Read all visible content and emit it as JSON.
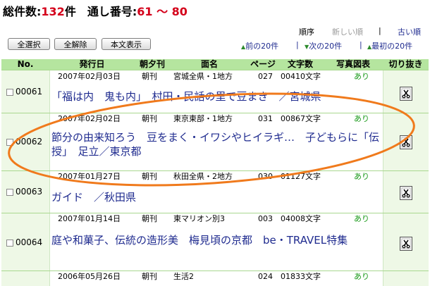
{
  "summary": {
    "total_label": "総件数:",
    "total_count": "132",
    "total_unit": "件",
    "serial_label": "通し番号:",
    "serial_range": "61 ～ 80"
  },
  "sort": {
    "label": "順序",
    "newest": "新しい順",
    "separator": "|",
    "oldest": "古い順"
  },
  "buttons": {
    "select_all": "全選択",
    "deselect_all": "全解除",
    "show_body": "本文表示"
  },
  "nav": {
    "prev": "前の20件",
    "sep": "|",
    "next": "次の20件",
    "first": "最初の20件"
  },
  "columns": {
    "no": "No.",
    "date": "発行日",
    "edition": "朝夕刊",
    "page_name": "面名",
    "page": "ページ",
    "chars": "文字数",
    "photo": "写真図表",
    "clip": "切り抜き"
  },
  "rows": [
    {
      "no": "00061",
      "date": "2007年02月03日",
      "edition": "朝刊",
      "page_name": "宮城全県・1地方",
      "page": "027",
      "chars": "00410文字",
      "photo": "あり",
      "title": "「福は内　鬼も内」　村田・民話の里で豆まき　／宮城県"
    },
    {
      "no": "00062",
      "date": "2007年02月02日",
      "edition": "朝刊",
      "page_name": "東京東部・1地方",
      "page": "031",
      "chars": "00867文字",
      "photo": "あり",
      "title": "節分の由来知ろう　豆をまく・イワシやヒイラギ…　子どもらに「伝授」　足立／東京都"
    },
    {
      "no": "00063",
      "date": "2007年01月27日",
      "edition": "朝刊",
      "page_name": "秋田全県・2地方",
      "page": "030",
      "chars": "01127文字",
      "photo": "あり",
      "title": "ガイド　／秋田県"
    },
    {
      "no": "00064",
      "date": "2007年01月14日",
      "edition": "朝刊",
      "page_name": "東マリオン別3",
      "page": "003",
      "chars": "04008文字",
      "photo": "あり",
      "title": "庭や和菓子、伝統の造形美　梅見頃の京都　be・TRAVEL特集"
    },
    {
      "no": "",
      "date": "2006年05月26日",
      "edition": "朝刊",
      "page_name": "生活2",
      "page": "024",
      "chars": "01833文字",
      "photo": "あり",
      "title": ""
    }
  ],
  "colors": {
    "accent_red": "#d4001a",
    "link_blue": "#1f2b8f",
    "header_green": "#b5e59f",
    "annotation_orange": "#f07a1c"
  }
}
